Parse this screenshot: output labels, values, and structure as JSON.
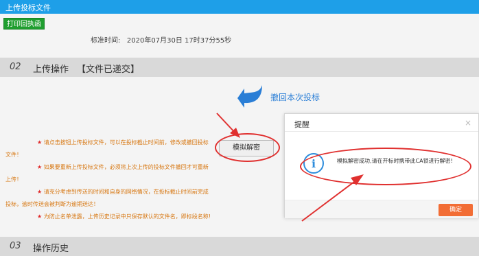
{
  "window": {
    "title": "上传投标文件"
  },
  "toolbar": {
    "print_label": "打印回执函"
  },
  "std_time": {
    "label": "标准时间:",
    "value": "2020年07月30日 17时37分55秒"
  },
  "section2": {
    "number": "02",
    "name": "上传操作",
    "status": "【文件已递交】"
  },
  "withdraw": {
    "label": "撤回本次投标"
  },
  "sim_button": {
    "label": "模拟解密"
  },
  "instructions": [
    "请点击按钮上传投标文件，可以在投标截止时间前，修改或撤回投标文件！",
    "如果要重新上传投标文件，必须将上次上传的投标文件撤回才可重新上传！",
    "请充分考虑到传送的时间和自身的网络情况，在投标截止时间前完成投标，逾时传送会被判断为逾期送达！",
    "为防止名单泄露，上传历史记录中只保存默认的文件名，即标段名称!"
  ],
  "star": "★",
  "section3": {
    "number": "03",
    "name": "操作历史"
  },
  "dialog": {
    "title": "提醒",
    "close": "×",
    "icon_glyph": "i",
    "message": "模拟解密成功,请在开标时携带此CA锁进行解密!",
    "ok_label": "确定"
  },
  "colors": {
    "titlebar": "#1e9fe8",
    "print_button": "#1f9e2f",
    "instruction_text": "#d77712",
    "annotation_red": "#e0302f",
    "ok_button": "#f26d35",
    "withdraw_text": "#2a7ed6"
  },
  "icons": {
    "withdraw": "undo-arrow-icon",
    "info": "info-icon"
  }
}
